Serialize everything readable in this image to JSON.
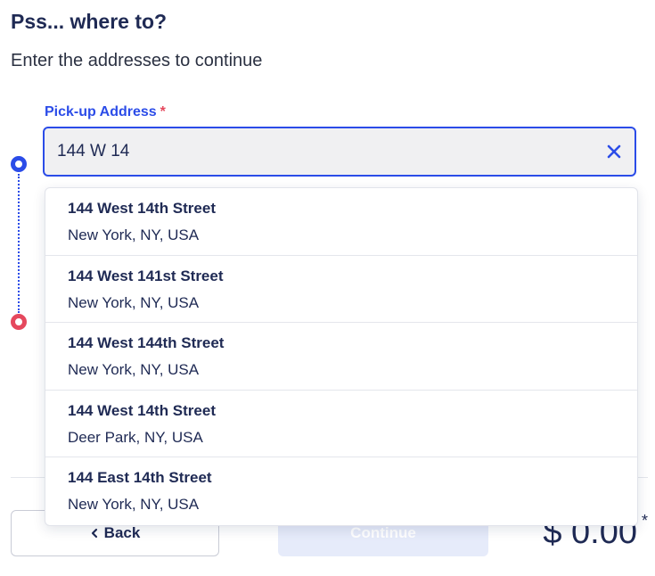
{
  "header": {
    "title": "Pss... where to?",
    "subtitle": "Enter the addresses to continue"
  },
  "pickup": {
    "label": "Pick-up Address",
    "required_mark": "*",
    "value": "144 W 14"
  },
  "suggestions": [
    {
      "street": "144 West 14th Street",
      "locality": "New York, NY, USA"
    },
    {
      "street": "144 West 141st Street",
      "locality": "New York, NY, USA"
    },
    {
      "street": "144 West 144th Street",
      "locality": "New York, NY, USA"
    },
    {
      "street": "144 West 14th Street",
      "locality": "Deer Park, NY, USA"
    },
    {
      "street": "144 East 14th Street",
      "locality": "New York, NY, USA"
    }
  ],
  "footer": {
    "back_label": "Back",
    "back_icon": "chevron-left-icon",
    "continue_label": "Continue",
    "price": "$ 0.00",
    "price_mark": "*"
  },
  "colors": {
    "accent": "#2b4ce8",
    "destination": "#e5485d",
    "text": "#1f2a54"
  },
  "icons": {
    "clear": "close-icon",
    "origin": "origin-marker-icon",
    "destination": "destination-marker-icon"
  }
}
